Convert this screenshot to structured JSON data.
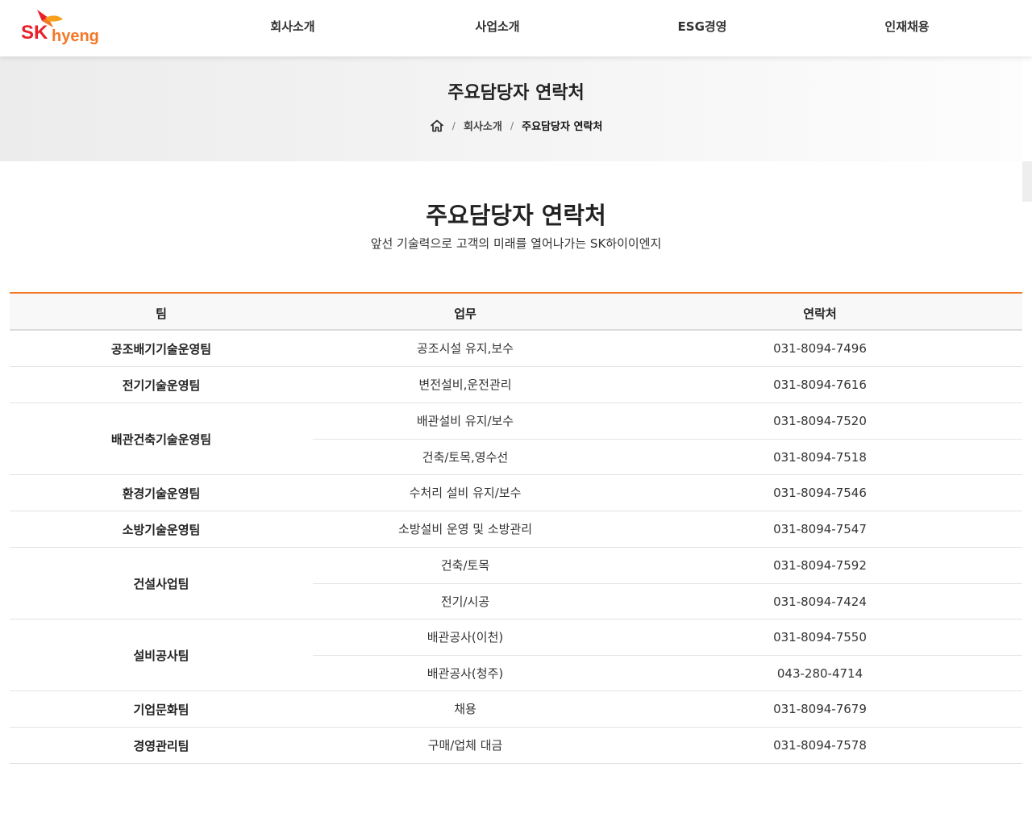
{
  "brand": {
    "logo_text_sk": "SK",
    "logo_text_name": "hyeng",
    "color_orange": "#f47725",
    "color_red": "#e8202a"
  },
  "nav": [
    "회사소개",
    "사업소개",
    "ESG경영",
    "인재채용"
  ],
  "banner": {
    "title": "주요담당자 연락처",
    "breadcrumb": {
      "home_icon": "home-icon",
      "level1": "회사소개",
      "separator": "/",
      "current": "주요담당자 연락처"
    }
  },
  "section": {
    "title": "주요담당자 연락처",
    "subtitle": "앞선 기술력으로 고객의 미래를 열어나가는 SK하이이엔지"
  },
  "table": {
    "headers": [
      "팀",
      "업무",
      "연락처"
    ],
    "groups": [
      {
        "team": "공조배기기술운영팀",
        "rows": [
          {
            "duty": "공조시설 유지,보수",
            "phone": "031-8094-7496"
          }
        ]
      },
      {
        "team": "전기기술운영팀",
        "rows": [
          {
            "duty": "변전설비,운전관리",
            "phone": "031-8094-7616"
          }
        ]
      },
      {
        "team": "배관건축기술운영팀",
        "rows": [
          {
            "duty": "배관설비 유지/보수",
            "phone": "031-8094-7520"
          },
          {
            "duty": "건축/토목,영수선",
            "phone": "031-8094-7518"
          }
        ]
      },
      {
        "team": "환경기술운영팀",
        "rows": [
          {
            "duty": "수처리 설비 유지/보수",
            "phone": "031-8094-7546"
          }
        ]
      },
      {
        "team": "소방기술운영팀",
        "rows": [
          {
            "duty": "소방설비 운영 및 소방관리",
            "phone": "031-8094-7547"
          }
        ]
      },
      {
        "team": "건설사업팀",
        "rows": [
          {
            "duty": "건축/토목",
            "phone": "031-8094-7592"
          },
          {
            "duty": "전기/시공",
            "phone": "031-8094-7424"
          }
        ]
      },
      {
        "team": "설비공사팀",
        "rows": [
          {
            "duty": "배관공사(이천)",
            "phone": "031-8094-7550"
          },
          {
            "duty": "배관공사(청주)",
            "phone": "043-280-4714"
          }
        ]
      },
      {
        "team": "기업문화팀",
        "rows": [
          {
            "duty": "채용",
            "phone": "031-8094-7679"
          }
        ]
      },
      {
        "team": "경영관리팀",
        "rows": [
          {
            "duty": "구매/업체 대금",
            "phone": "031-8094-7578"
          }
        ]
      }
    ]
  }
}
